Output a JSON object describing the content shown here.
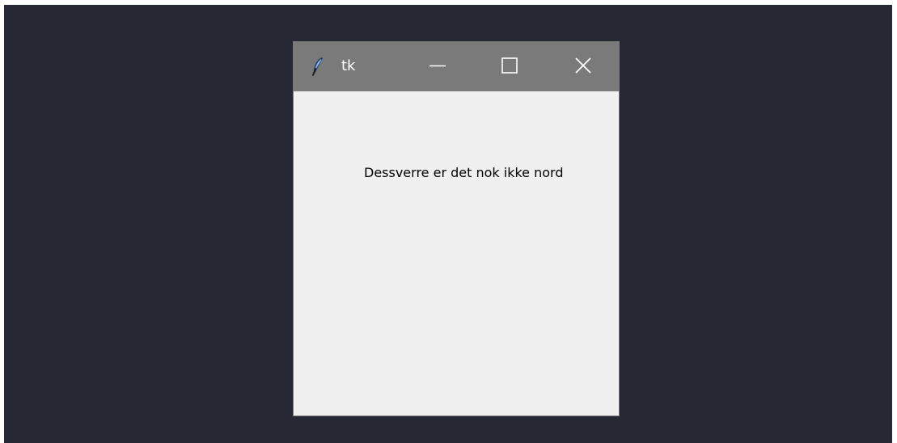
{
  "window": {
    "title": "tk",
    "icon": "feather-icon",
    "controls": {
      "minimize": "minimize-icon",
      "maximize": "maximize-icon",
      "close": "close-icon"
    }
  },
  "content": {
    "message": "Dessverre er det nok ikke nord"
  },
  "colors": {
    "desktop": "#262833",
    "titlebar": "#7a7a7a",
    "client": "#f0f0f0"
  }
}
